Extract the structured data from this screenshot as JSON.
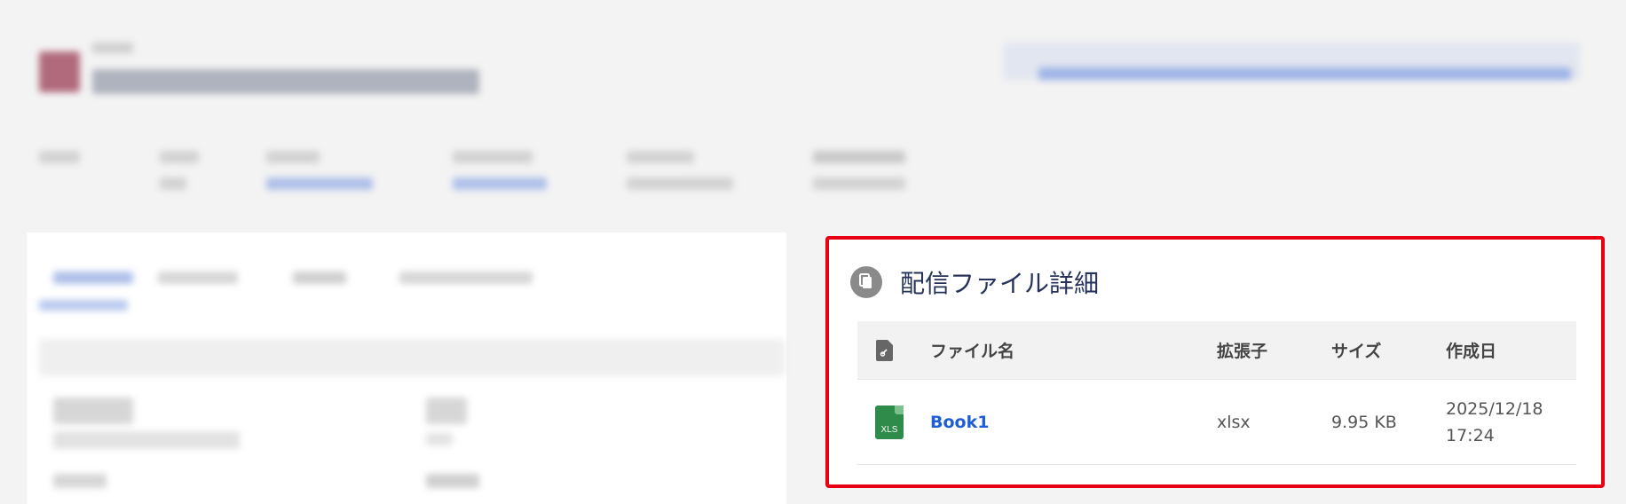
{
  "panel": {
    "title": "配信ファイル詳細",
    "title_icon": "documents-icon"
  },
  "table": {
    "headers": {
      "icon": "file-attachment-icon",
      "name": "ファイル名",
      "ext": "拡張子",
      "size": "サイズ",
      "created": "作成日"
    },
    "rows": [
      {
        "icon": "xls-file-icon",
        "icon_label": "XLS",
        "name": "Book1",
        "ext": "xlsx",
        "size": "9.95 KB",
        "created_date": "2025/12/18",
        "created_time": "17:24"
      }
    ]
  },
  "colors": {
    "accent_border": "#e60012",
    "link": "#1f5fd6",
    "title": "#26325a",
    "xls_green": "#2e8b4a"
  }
}
